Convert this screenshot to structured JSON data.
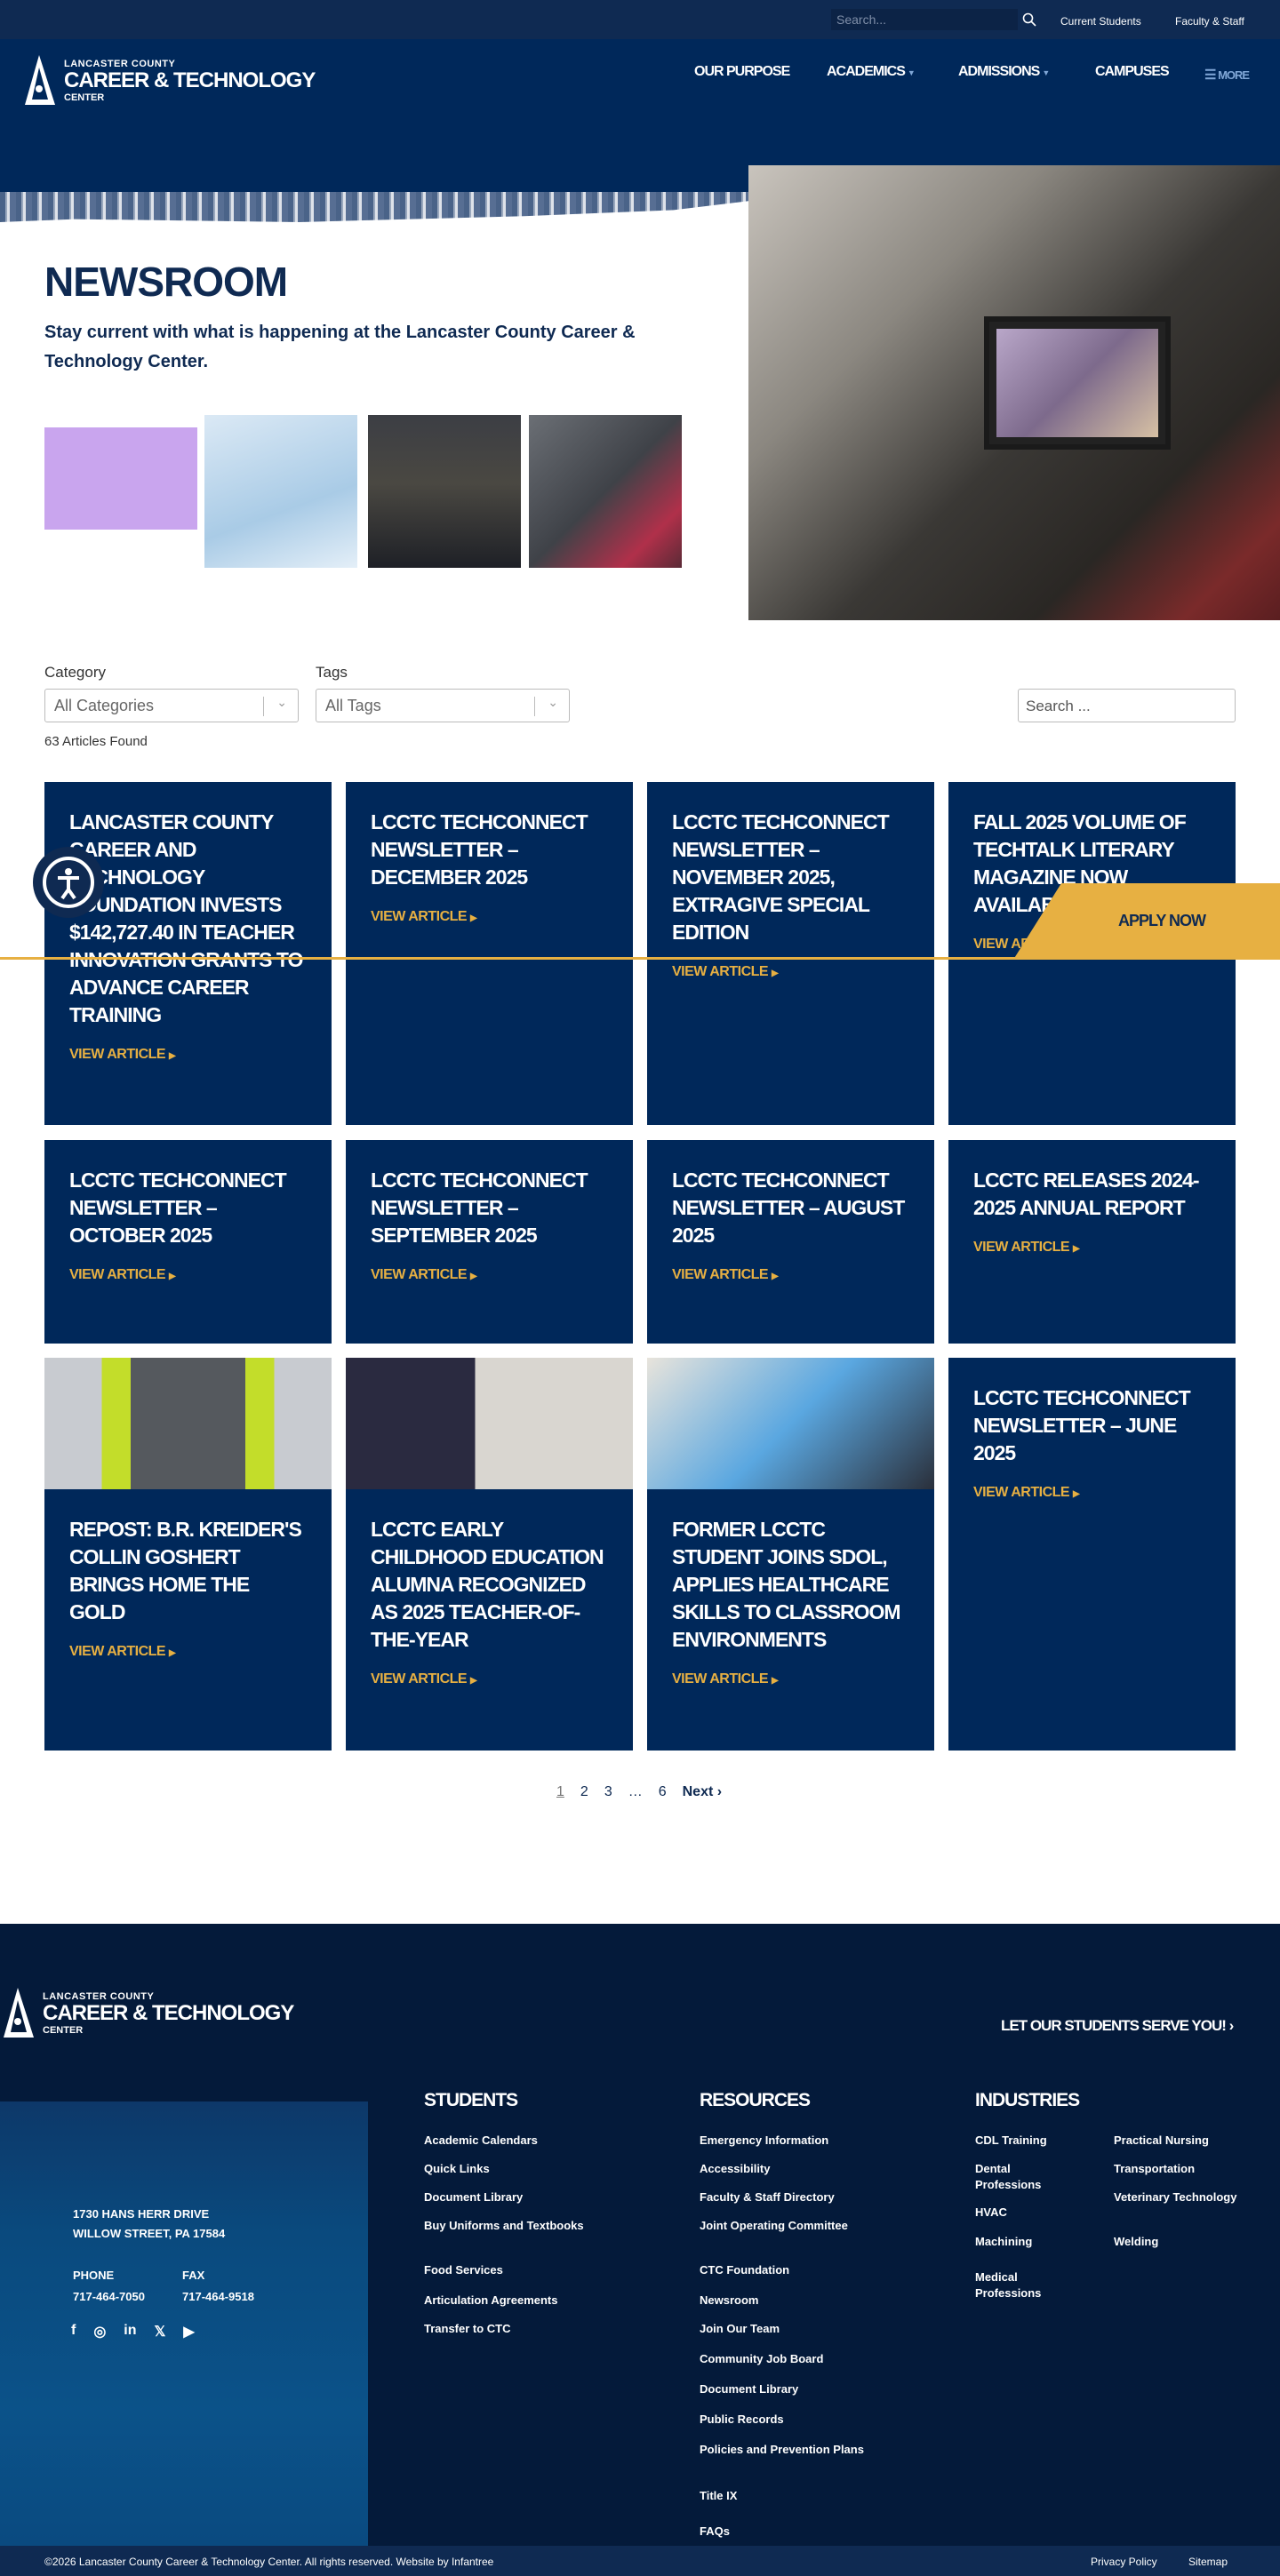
{
  "topbar": {
    "search_placeholder": "Search...",
    "links": [
      "Current Students",
      "Faculty & Staff"
    ]
  },
  "logo": {
    "line1": "LANCASTER COUNTY",
    "line2": "CAREER & TECHNOLOGY",
    "line3": "CENTER"
  },
  "nav": {
    "items": [
      "OUR PURPOSE",
      "ACADEMICS",
      "ADMISSIONS",
      "CAMPUSES"
    ],
    "more": "MORE"
  },
  "hero": {
    "title": "NEWSROOM",
    "subtitle": "Stay current with what is happening at the Lancaster County Career & Technology Center."
  },
  "filters": {
    "category_label": "Category",
    "category_value": "All Categories",
    "tags_label": "Tags",
    "tags_value": "All Tags",
    "search_placeholder": "Search ...",
    "count": "63 Articles Found"
  },
  "articles": [
    {
      "title": "Lancaster County Career and Technology Foundation Invests $142,727.40 in Teacher Innovation Grants to Advance Career Training",
      "link": "VIEW ARTICLE"
    },
    {
      "title": "LCCTC TechConnect Newsletter – December 2025",
      "link": "VIEW ARTICLE"
    },
    {
      "title": "LCCTC TechConnect Newsletter – November 2025, ExtraGive Special Edition",
      "link": "VIEW ARTICLE"
    },
    {
      "title": "Fall 2025 Volume of TechTalk Literary Magazine Now Available",
      "link": "VIEW ARTICLE"
    },
    {
      "title": "LCCTC TechConnect Newsletter – October 2025",
      "link": "VIEW ARTICLE"
    },
    {
      "title": "LCCTC TechConnect Newsletter – September 2025",
      "link": "VIEW ARTICLE"
    },
    {
      "title": "LCCTC TechConnect Newsletter – August 2025",
      "link": "VIEW ARTICLE"
    },
    {
      "title": "LCCTC Releases 2024-2025 Annual Report",
      "link": "VIEW ARTICLE"
    },
    {
      "title": "Repost: B.R. Kreider's Collin Goshert Brings Home the Gold",
      "link": "VIEW ARTICLE"
    },
    {
      "title": "LCCTC Early Childhood Education Alumna Recognized as 2025 Teacher-of-the-Year",
      "link": "VIEW ARTICLE"
    },
    {
      "title": "Former LCCTC Student Joins SDOL, Applies Healthcare Skills to Classroom Environments",
      "link": "VIEW ARTICLE"
    },
    {
      "title": "LCCTC TechConnect Newsletter – June 2025",
      "link": "VIEW ARTICLE"
    }
  ],
  "pagination": {
    "pages": [
      "1",
      "2",
      "3",
      "…",
      "6"
    ],
    "next": "Next ›"
  },
  "floating": {
    "apply": "APPLY NOW"
  },
  "footer": {
    "cta": "LET OUR STUDENTS SERVE YOU! ›",
    "address1": "1730 HANS HERR DRIVE",
    "address2": "WILLOW STREET, PA 17584",
    "phone_label": "PHONE",
    "phone": "717-464-7050",
    "fax_label": "FAX",
    "fax": "717-464-9518",
    "students_h": "STUDENTS",
    "students": [
      "Academic Calendars",
      "Quick Links",
      "Document Library",
      "Buy Uniforms and Textbooks",
      "Food Services",
      "Articulation Agreements",
      "Transfer to CTC"
    ],
    "resources_h": "RESOURCES",
    "resources": [
      "Emergency Information",
      "Accessibility",
      "Faculty & Staff Directory",
      "Joint Operating Committee",
      "CTC Foundation",
      "Newsroom",
      "Join Our Team",
      "Community Job Board",
      "Document Library",
      "Public Records",
      "Policies and Prevention Plans",
      "Title IX",
      "FAQs"
    ],
    "industries_h": "INDUSTRIES",
    "industries_a": [
      "CDL Training",
      "Dental Professions",
      "HVAC",
      "Machining",
      "Medical Professions"
    ],
    "industries_b": [
      "Practical Nursing",
      "Transportation",
      "Veterinary Technology",
      "Welding"
    ],
    "copyright": "©2026 Lancaster County Career & Technology Center. All rights reserved. Website by Infantree",
    "privacy": "Privacy Policy",
    "sitemap": "Sitemap"
  },
  "colors": {
    "navy": "#00285a",
    "gold": "#e7b042",
    "footer": "#041a3a"
  }
}
